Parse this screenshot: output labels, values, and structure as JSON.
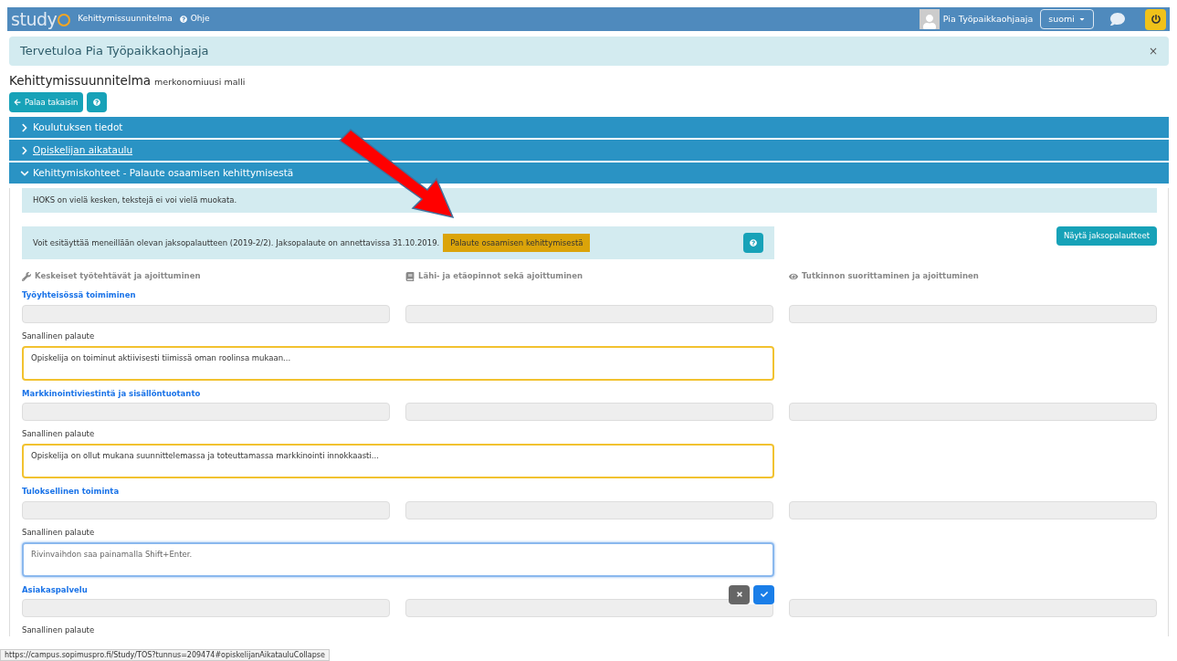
{
  "topbar": {
    "logo": "study",
    "nav": [
      {
        "label": "Kehittymissuunnitelma",
        "kind": "text"
      },
      {
        "label": "Ohje",
        "kind": "help"
      }
    ],
    "user": "Pia Työpaikkaohjaaja",
    "language": "suomi"
  },
  "welcome": {
    "text": "Tervetuloa Pia Työpaikkaohjaaja",
    "close": "×"
  },
  "page_title": "Kehittymissuunnitelma",
  "page_subtitle": "merkonomiuusi malli",
  "back_button": "Palaa takaisin",
  "accordions": [
    {
      "label": "Koulutuksen tiedot",
      "expanded": false,
      "underlined": false
    },
    {
      "label": "Opiskelijan aikataulu",
      "expanded": false,
      "underlined": true
    },
    {
      "label": "Kehittymiskohteet - Palaute osaamisen kehittymisestä",
      "expanded": true,
      "underlined": false
    }
  ],
  "notice": "HOKS on vielä kesken, tekstejä ei voi vielä muokata.",
  "info": {
    "text": "Voit esitäyttää meneillään olevan jaksopalautteen (2019-2/2). Jaksopalaute on annettavissa 31.10.2019.",
    "button": "Palaute osaamisen kehittymisestä"
  },
  "show_button": "Näytä jaksopalautteet",
  "columns": [
    {
      "label": "Keskeiset työtehtävät ja ajoittuminen",
      "kind": "wrench"
    },
    {
      "label": "Lähi- ja etäopinnot sekä ajoittuminen",
      "kind": "book"
    },
    {
      "label": "Tutkinnon suorittaminen ja ajoittuminen",
      "kind": "eye"
    }
  ],
  "sections": [
    {
      "title": "Työyhteisössä toimiminen",
      "feedback_label": "Sanallinen palaute",
      "value": "Opiskelija on toiminut aktiivisesti tiimissä oman roolinsa mukaan...",
      "edited": true,
      "focused": false
    },
    {
      "title": "Markkinointiviestintä ja sisällöntuotanto",
      "feedback_label": "Sanallinen palaute",
      "value": "Opiskelija on ollut mukana suunnittelemassa ja toteuttamassa markkinointi innokkaasti...",
      "edited": true,
      "focused": false
    },
    {
      "title": "Tuloksellinen toiminta",
      "feedback_label": "Sanallinen palaute",
      "placeholder": "Rivinvaihdon saa painamalla Shift+Enter.",
      "edited": false,
      "focused": true
    },
    {
      "title": "Asiakaspalvelu",
      "feedback_label": "Sanallinen palaute"
    }
  ],
  "status_url": "https://campus.sopimuspro.fi/Study/TOS?tunnus=209474#opiskelijanAikatauluCollapse"
}
